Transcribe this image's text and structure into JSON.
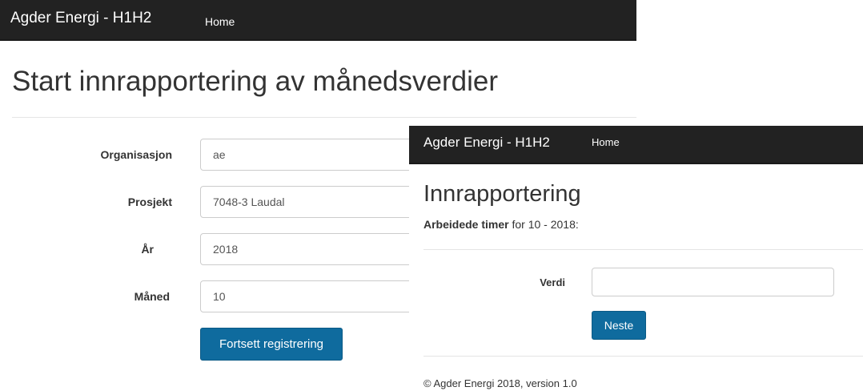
{
  "left": {
    "navbar": {
      "brand": "Agder Energi - H1H2",
      "home": "Home"
    },
    "page_title": "Start innrapportering av månedsverdier",
    "form": {
      "organisasjon_label": "Organisasjon",
      "organisasjon_value": "ae",
      "prosjekt_label": "Prosjekt",
      "prosjekt_value": "7048-3 Laudal",
      "ar_label": "År",
      "ar_value": "2018",
      "maned_label": "Måned",
      "maned_value": "10",
      "submit_label": "Fortsett registrering"
    }
  },
  "right": {
    "navbar": {
      "brand": "Agder Energi - H1H2",
      "home": "Home"
    },
    "page_title": "Innrapportering",
    "subtitle_bold": "Arbeidede timer",
    "subtitle_rest": " for 10 - 2018:",
    "verdi_label": "Verdi",
    "verdi_value": "",
    "next_label": "Neste",
    "footer": "© Agder Energi 2018, version 1.0"
  }
}
